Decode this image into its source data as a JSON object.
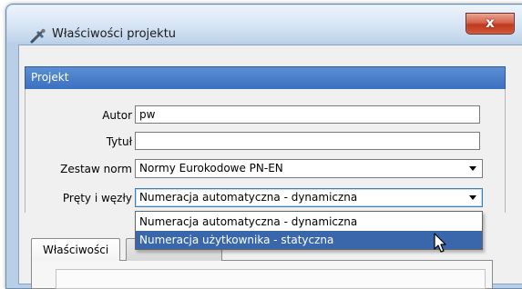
{
  "window": {
    "title": "Właściwości projektu",
    "icon": "wrench-hammer-icon",
    "close_label": "x"
  },
  "group": {
    "header": "Projekt"
  },
  "form": {
    "autor_label": "Autor",
    "autor_value": "pw",
    "tytul_label": "Tytuł",
    "tytul_value": "",
    "norms_label": "Zestaw norm",
    "norms_value": "Normy Eurokodowe PN-EN",
    "prety_label": "Pręty i węzły",
    "prety_value": "Numeracja automatyczna - dynamiczna"
  },
  "dropdown": {
    "options": [
      "Numeracja automatyczna - dynamiczna",
      "Numeracja użytkownika - statyczna"
    ],
    "highlighted_index": 1
  },
  "tabs": {
    "items": [
      "Właściwości",
      ""
    ]
  },
  "colors": {
    "header_blue": "#3c6fc0",
    "selection_blue": "#3a67ab",
    "close_red": "#c0391e"
  }
}
